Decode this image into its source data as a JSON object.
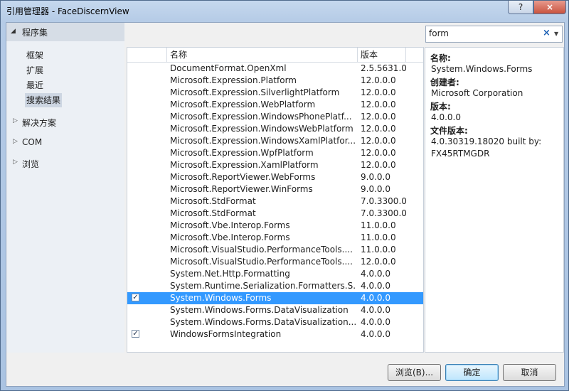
{
  "window": {
    "title": "引用管理器 - FaceDiscernView",
    "help": "?",
    "close": "×"
  },
  "nav": {
    "header": "程序集",
    "sub_items": [
      "框架",
      "扩展",
      "最近",
      "搜索结果"
    ],
    "groups": [
      "解决方案",
      "COM",
      "浏览"
    ]
  },
  "search": {
    "value": "form",
    "clear": "×",
    "dropdown": "▼"
  },
  "table": {
    "headers": {
      "name": "名称",
      "version": "版本"
    },
    "rows": [
      {
        "name": "DocumentFormat.OpenXml",
        "version": "2.5.5631.0",
        "checked": false,
        "selected": false
      },
      {
        "name": "Microsoft.Expression.Platform",
        "version": "12.0.0.0",
        "checked": false,
        "selected": false
      },
      {
        "name": "Microsoft.Expression.SilverlightPlatform",
        "version": "12.0.0.0",
        "checked": false,
        "selected": false
      },
      {
        "name": "Microsoft.Expression.WebPlatform",
        "version": "12.0.0.0",
        "checked": false,
        "selected": false
      },
      {
        "name": "Microsoft.Expression.WindowsPhonePlatf...",
        "version": "12.0.0.0",
        "checked": false,
        "selected": false
      },
      {
        "name": "Microsoft.Expression.WindowsWebPlatform",
        "version": "12.0.0.0",
        "checked": false,
        "selected": false
      },
      {
        "name": "Microsoft.Expression.WindowsXamlPlatfor...",
        "version": "12.0.0.0",
        "checked": false,
        "selected": false
      },
      {
        "name": "Microsoft.Expression.WpfPlatform",
        "version": "12.0.0.0",
        "checked": false,
        "selected": false
      },
      {
        "name": "Microsoft.Expression.XamlPlatform",
        "version": "12.0.0.0",
        "checked": false,
        "selected": false
      },
      {
        "name": "Microsoft.ReportViewer.WebForms",
        "version": "9.0.0.0",
        "checked": false,
        "selected": false
      },
      {
        "name": "Microsoft.ReportViewer.WinForms",
        "version": "9.0.0.0",
        "checked": false,
        "selected": false
      },
      {
        "name": "Microsoft.StdFormat",
        "version": "7.0.3300.0",
        "checked": false,
        "selected": false
      },
      {
        "name": "Microsoft.StdFormat",
        "version": "7.0.3300.0",
        "checked": false,
        "selected": false
      },
      {
        "name": "Microsoft.Vbe.Interop.Forms",
        "version": "11.0.0.0",
        "checked": false,
        "selected": false
      },
      {
        "name": "Microsoft.Vbe.Interop.Forms",
        "version": "11.0.0.0",
        "checked": false,
        "selected": false
      },
      {
        "name": "Microsoft.VisualStudio.PerformanceTools....",
        "version": "11.0.0.0",
        "checked": false,
        "selected": false
      },
      {
        "name": "Microsoft.VisualStudio.PerformanceTools....",
        "version": "12.0.0.0",
        "checked": false,
        "selected": false
      },
      {
        "name": "System.Net.Http.Formatting",
        "version": "4.0.0.0",
        "checked": false,
        "selected": false
      },
      {
        "name": "System.Runtime.Serialization.Formatters.S...",
        "version": "4.0.0.0",
        "checked": false,
        "selected": false
      },
      {
        "name": "System.Windows.Forms",
        "version": "4.0.0.0",
        "checked": true,
        "selected": true
      },
      {
        "name": "System.Windows.Forms.DataVisualization",
        "version": "4.0.0.0",
        "checked": false,
        "selected": false
      },
      {
        "name": "System.Windows.Forms.DataVisualization....",
        "version": "4.0.0.0",
        "checked": false,
        "selected": false
      },
      {
        "name": "WindowsFormsIntegration",
        "version": "4.0.0.0",
        "checked": true,
        "selected": false
      }
    ]
  },
  "details": {
    "name_label": "名称:",
    "name_value": "System.Windows.Forms",
    "creator_label": "创建者:",
    "creator_value": "Microsoft Corporation",
    "version_label": "版本:",
    "version_value": "4.0.0.0",
    "file_version_label": "文件版本:",
    "file_version_line1": "4.0.30319.18020 built by:",
    "file_version_line2": "FX45RTMGDR"
  },
  "buttons": {
    "browse": "浏览(B)...",
    "ok": "确定",
    "cancel": "取消"
  },
  "checkmark": "✓"
}
